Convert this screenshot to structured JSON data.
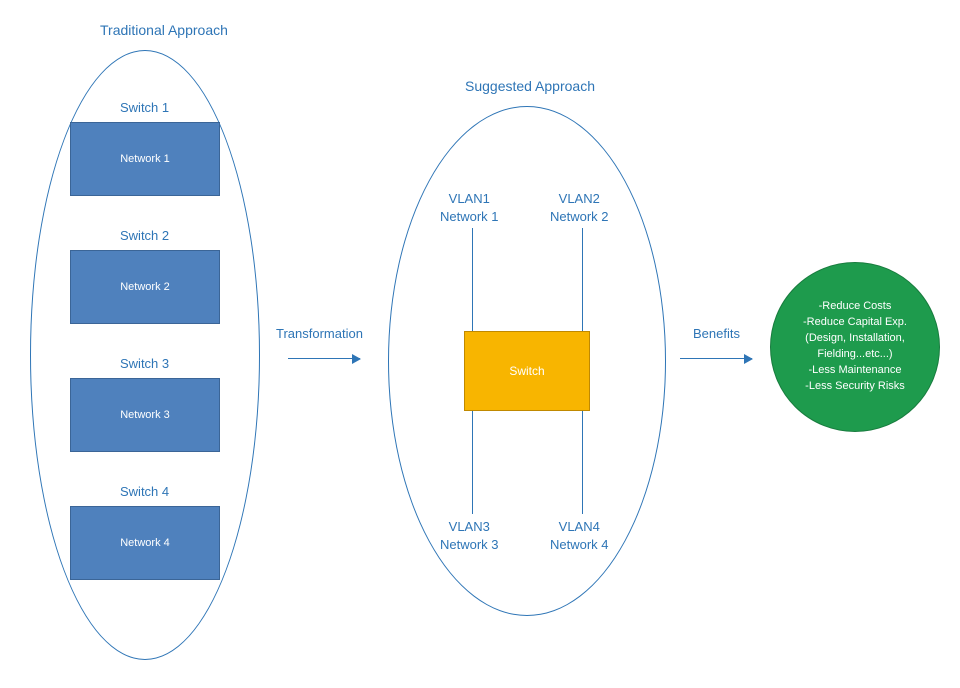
{
  "headings": {
    "traditional": "Traditional Approach",
    "suggested": "Suggested Approach"
  },
  "traditional": {
    "items": [
      {
        "caption": "Switch 1",
        "label": "Network 1"
      },
      {
        "caption": "Switch 2",
        "label": "Network 2"
      },
      {
        "caption": "Switch 3",
        "label": "Network 3"
      },
      {
        "caption": "Switch 4",
        "label": "Network 4"
      }
    ]
  },
  "suggested": {
    "switch_label": "Switch",
    "vlans": {
      "top_left": {
        "vlan": "VLAN1",
        "net": "Network 1"
      },
      "top_right": {
        "vlan": "VLAN2",
        "net": "Network 2"
      },
      "bottom_left": {
        "vlan": "VLAN3",
        "net": "Network 3"
      },
      "bottom_right": {
        "vlan": "VLAN4",
        "net": "Network 4"
      }
    }
  },
  "arrows": {
    "transform": "Transformation",
    "benefits": "Benefits"
  },
  "benefits": {
    "lines": [
      "-Reduce Costs",
      "-Reduce Capital Exp.",
      "(Design, Installation,",
      "Fielding...etc...)",
      "-Less Maintenance",
      "-Less Security Risks"
    ]
  }
}
